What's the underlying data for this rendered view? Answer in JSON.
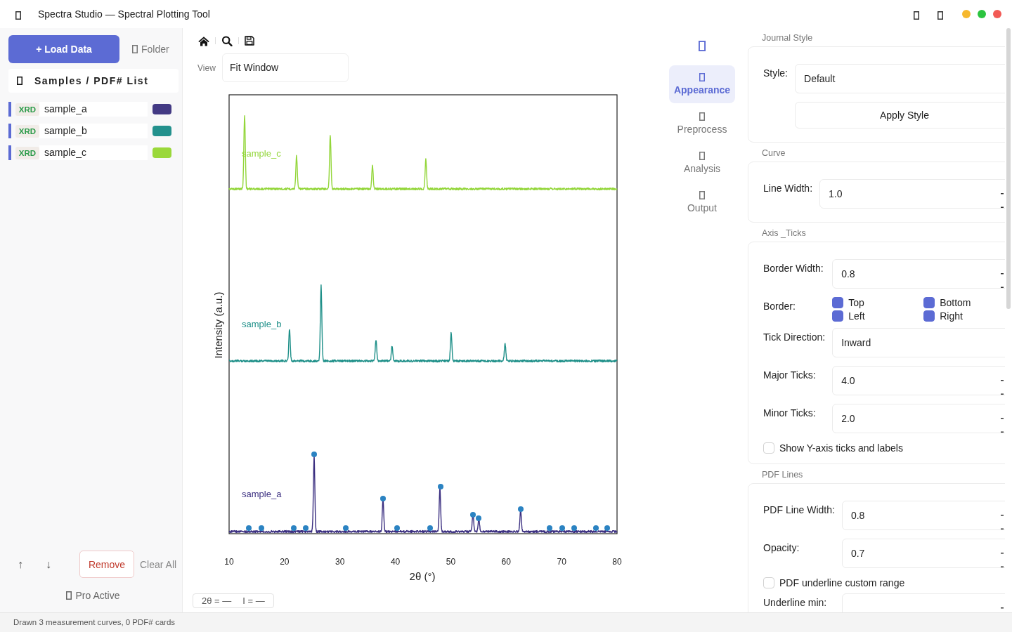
{
  "window": {
    "title": "Spectra Studio — Spectral Plotting Tool"
  },
  "sidebar": {
    "load_button": "+ Load Data",
    "folder_button": "Folder",
    "list_title": "Samples / PDF# List",
    "items": [
      {
        "tag": "XRD",
        "name": "sample_a",
        "color": "#433a84"
      },
      {
        "tag": "XRD",
        "name": "sample_b",
        "color": "#23918d"
      },
      {
        "tag": "XRD",
        "name": "sample_c",
        "color": "#9ad83a"
      }
    ],
    "move_up": "↑",
    "move_down": "↓",
    "remove_button": "Remove",
    "clear_button": "Clear All",
    "license": "Pro Active"
  },
  "toolbar": {
    "view_label": "View",
    "view_value": "Fit Window"
  },
  "plot": {
    "curves": [
      {
        "label": "sample_c",
        "color": "#93d63a"
      },
      {
        "label": "sample_b",
        "color": "#1f9089"
      },
      {
        "label": "sample_a",
        "color": "#3b2f80"
      }
    ],
    "x_tick_labels": [
      "10",
      "20",
      "30",
      "40",
      "50",
      "60",
      "70",
      "80"
    ],
    "xlabel": "2θ (°)",
    "ylabel": "Intensity (a.u.)",
    "readout": [
      "2θ = —",
      "I = —"
    ]
  },
  "nav": {
    "items": [
      {
        "label": "Appearance",
        "selected": true
      },
      {
        "label": "Preprocess",
        "selected": false
      },
      {
        "label": "Analysis",
        "selected": false
      },
      {
        "label": "Output",
        "selected": false
      }
    ]
  },
  "panel": {
    "sections": [
      {
        "title": "Journal Style",
        "rows": [
          {
            "kind": "select",
            "label": "Style:",
            "value": "Default"
          },
          {
            "kind": "button",
            "label": "Apply Style"
          }
        ]
      },
      {
        "title": "Curve",
        "rows": [
          {
            "kind": "spin",
            "label": "Line Width:",
            "value": "1.0"
          }
        ]
      },
      {
        "title": "Axis _Ticks",
        "rows": [
          {
            "kind": "spin",
            "label": "Border Width:",
            "value": "0.8"
          },
          {
            "kind": "checks",
            "label": "Border:",
            "options": [
              {
                "label": "Top",
                "checked": true
              },
              {
                "label": "Bottom",
                "checked": true
              },
              {
                "label": "Left",
                "checked": true
              },
              {
                "label": "Right",
                "checked": true
              }
            ]
          },
          {
            "kind": "select",
            "label": "Tick Direction:",
            "value": "Inward"
          },
          {
            "kind": "spin",
            "label": "Major Ticks:",
            "value": "4.0"
          },
          {
            "kind": "spin",
            "label": "Minor Ticks:",
            "value": "2.0"
          },
          {
            "kind": "checkbox",
            "label": "Show Y-axis ticks and labels",
            "checked": false
          }
        ]
      },
      {
        "title": "PDF Lines",
        "rows": [
          {
            "kind": "spin",
            "label": "PDF Line Width:",
            "value": "0.8"
          },
          {
            "kind": "spin",
            "label": "Opacity:",
            "value": "0.7"
          },
          {
            "kind": "checkbox",
            "label": "PDF underline custom range",
            "checked": false
          },
          {
            "kind": "spin",
            "label": "Underline min:"
          }
        ]
      }
    ]
  },
  "status_bar": {
    "text": "Drawn 3 measurement curves, 0 PDF# cards"
  }
}
